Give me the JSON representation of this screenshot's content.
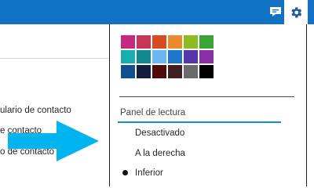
{
  "header": {
    "bar_color": "#0f72c4",
    "icons": [
      "chat-icon",
      "gear-icon"
    ]
  },
  "left_list": {
    "items": [
      {
        "label": "ulario de contacto"
      },
      {
        "label": "e contacto"
      },
      {
        "label": "o de contacto"
      }
    ]
  },
  "theme_colors": [
    [
      "#c5287d",
      "#c73657",
      "#d94b21",
      "#ec8a2b",
      "#8cbb22",
      "#3aa534"
    ],
    [
      "#17aeae",
      "#12898f",
      "#6ab7f2",
      "#1d78cd",
      "#5537a9",
      "#8a2fa1"
    ],
    [
      "#11508c",
      "#141f3d",
      "#4e0b0b",
      "#3f1f22",
      "#6b6b6b",
      "#000000"
    ]
  ],
  "reading_pane": {
    "title": "Panel de lectura",
    "options": [
      {
        "label": "Desactivado",
        "selected": false
      },
      {
        "label": "A la derecha",
        "selected": false
      },
      {
        "label": "Inferior",
        "selected": true
      }
    ]
  },
  "overlay": {
    "arrow_color": "#00b4ef",
    "arrow_icon": "arrow-right-icon"
  }
}
